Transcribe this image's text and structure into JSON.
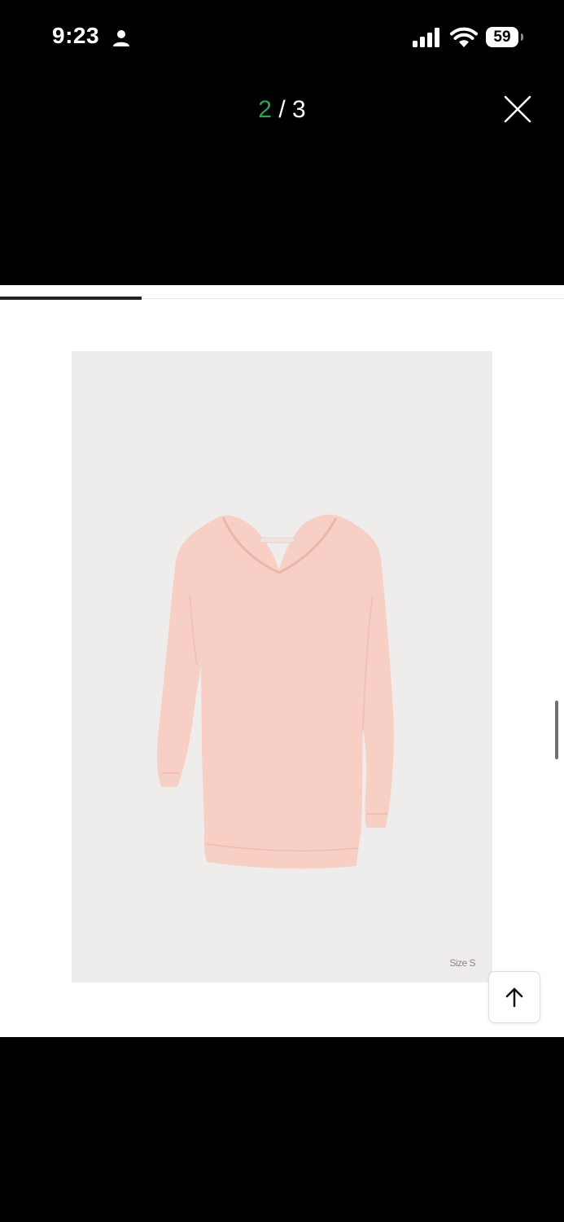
{
  "status_bar": {
    "time": "9:23",
    "battery": "59",
    "icons": [
      "person-icon",
      "signal-icon",
      "wifi-icon",
      "battery-icon"
    ]
  },
  "viewer": {
    "current_index": "2",
    "separator": "/",
    "total": "3",
    "close_icon": "close-icon",
    "progress": 0.25
  },
  "product": {
    "image_caption": "Size S",
    "garment_color": "#f7cfc4",
    "background_color": "#efedeb"
  },
  "scroll_top_button": {
    "icon": "arrow-up-icon"
  },
  "colors": {
    "accent_counter": "#2ea54a",
    "background": "#000000",
    "content_background": "#ffffff"
  }
}
